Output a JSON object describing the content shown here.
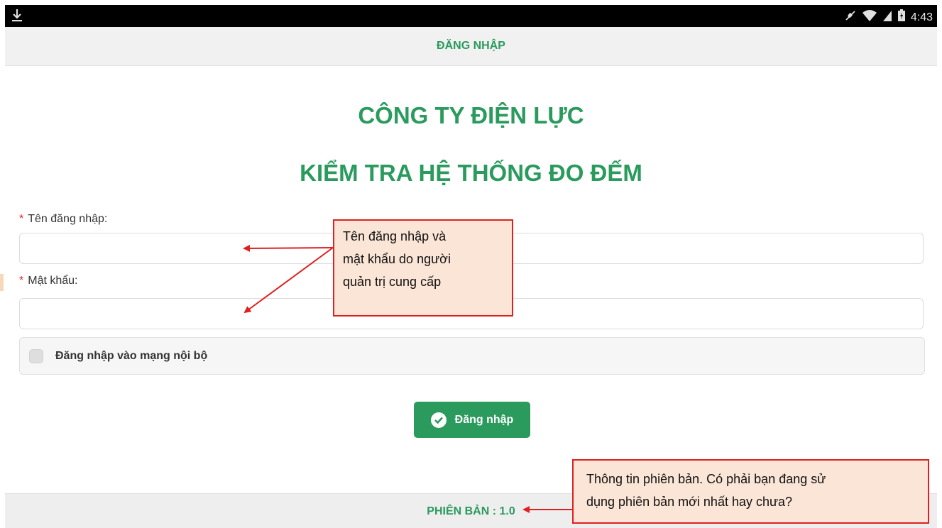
{
  "status_bar": {
    "time": "4:43",
    "icons": [
      "download-icon",
      "mute-icon",
      "wifi-icon",
      "signal-icon",
      "battery-icon"
    ]
  },
  "header": {
    "title": "ĐĂNG NHẬP"
  },
  "app": {
    "title_line1": "CÔNG TY ĐIỆN LỰC",
    "title_line2": "KIỂM TRA HỆ THỐNG ĐO ĐẾM"
  },
  "form": {
    "required_mark": "*",
    "username_label": "Tên đăng nhập:",
    "username_value": "",
    "password_label": "Mật khẩu:",
    "password_value": "",
    "intranet_checkbox_label": "Đăng nhập vào mạng nội bộ",
    "intranet_checked": false,
    "login_button_label": "Đăng nhập"
  },
  "footer": {
    "version_text": "PHIÊN BẢN : 1.0"
  },
  "annotations": {
    "credentials_note_lines": [
      "Tên đăng nhập và",
      "mật khẩu do người",
      "quản trị cung cấp"
    ],
    "version_note_lines": [
      "Thông tin phiên bản. Có phải bạn đang sử",
      "dụng phiên bản mới nhất hay chưa?"
    ]
  },
  "colors": {
    "accent": "#2a9a5d",
    "annotation_border": "#e02020",
    "annotation_fill": "#fbe5d6",
    "required": "#d9262e"
  }
}
